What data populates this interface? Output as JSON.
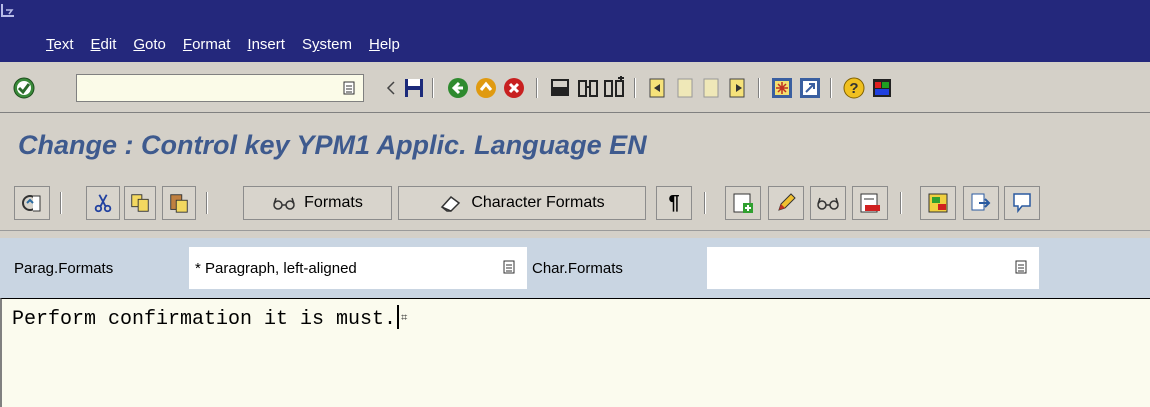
{
  "menu": {
    "items": [
      {
        "label": "Text",
        "accel": "T"
      },
      {
        "label": "Edit",
        "accel": "E"
      },
      {
        "label": "Goto",
        "accel": "G"
      },
      {
        "label": "Format",
        "accel": "F"
      },
      {
        "label": "Insert",
        "accel": "I"
      },
      {
        "label": "System",
        "accel": "y"
      },
      {
        "label": "Help",
        "accel": "H"
      }
    ]
  },
  "toolbar": {
    "command_value": "",
    "icons": [
      "enter-icon",
      "save-icon",
      "back-icon",
      "exit-icon",
      "cancel-icon",
      "print-icon",
      "find-icon",
      "find-next-icon",
      "first-page-icon",
      "previous-page-icon",
      "next-page-icon",
      "last-page-icon",
      "create-session-icon",
      "shortcut-icon",
      "help-icon",
      "customize-layout-icon"
    ]
  },
  "title": "Change : Control key YPM1 Applic. Language EN",
  "app_toolbar": {
    "formats_label": "Formats",
    "character_formats_label": "Character Formats",
    "paragraph_mark_label": "¶"
  },
  "format_bar": {
    "parag_label": "Parag.Formats",
    "parag_value": "* Paragraph, left-aligned",
    "char_label": "Char.Formats",
    "char_value": ""
  },
  "editor": {
    "text": "Perform confirmation it is must.",
    "end_mark": "⌗"
  },
  "colors": {
    "menubar": "#24287c",
    "title": "#3e5a8e",
    "format_bar": "#c9d5e2",
    "editor_bg": "#fbfbee"
  }
}
